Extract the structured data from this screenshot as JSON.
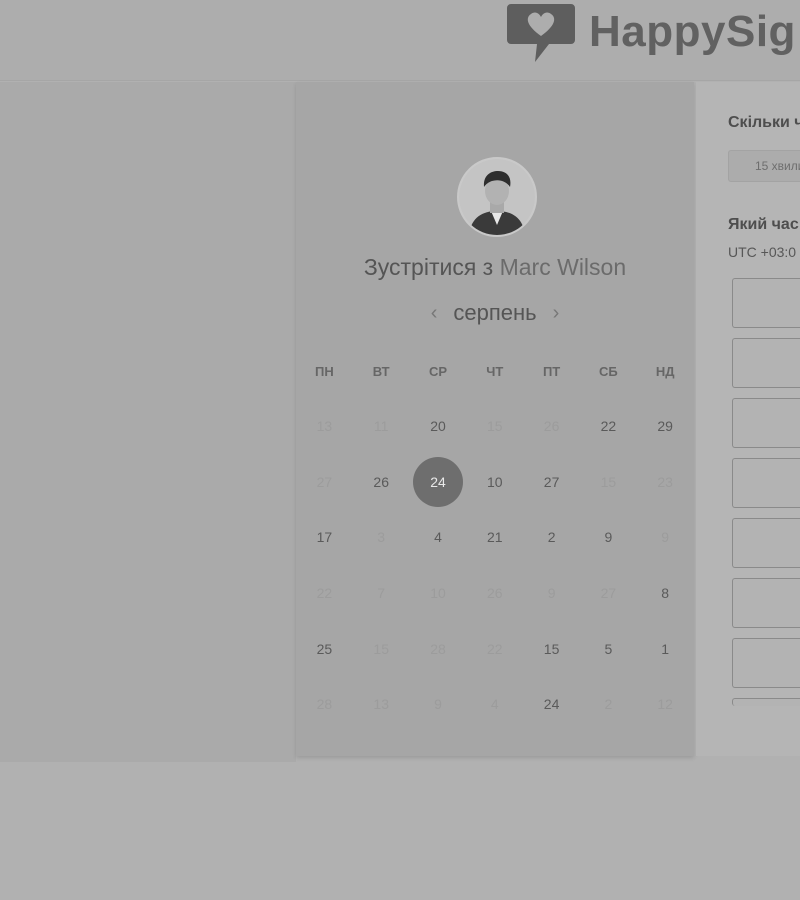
{
  "brand": {
    "name": "HappySig",
    "logo_icon": "heart-speech-bubble-icon",
    "logo_color": "#5e5e5e"
  },
  "calendar": {
    "meet_prefix": "Зустрітися з",
    "meet_name": "Marc Wilson",
    "avatar_icon": "user-avatar",
    "month": "серпень",
    "prev_icon": "chevron-left-icon",
    "next_icon": "chevron-right-icon",
    "prev_glyph": "‹",
    "next_glyph": "›",
    "weekdays": [
      "ПН",
      "ВТ",
      "СР",
      "ЧТ",
      "ПТ",
      "СБ",
      "НД"
    ],
    "weeks": [
      [
        {
          "d": "13",
          "m": true
        },
        {
          "d": "11",
          "m": true
        },
        {
          "d": "20",
          "m": false
        },
        {
          "d": "15",
          "m": true
        },
        {
          "d": "26",
          "m": true
        },
        {
          "d": "22",
          "m": false
        },
        {
          "d": "29",
          "m": false
        }
      ],
      [
        {
          "d": "27",
          "m": true
        },
        {
          "d": "26",
          "m": false
        },
        {
          "d": "24",
          "m": false,
          "sel": true
        },
        {
          "d": "10",
          "m": false
        },
        {
          "d": "27",
          "m": false
        },
        {
          "d": "15",
          "m": true
        },
        {
          "d": "23",
          "m": true
        }
      ],
      [
        {
          "d": "17",
          "m": false
        },
        {
          "d": "3",
          "m": true
        },
        {
          "d": "4",
          "m": false
        },
        {
          "d": "21",
          "m": false
        },
        {
          "d": "2",
          "m": false
        },
        {
          "d": "9",
          "m": false
        },
        {
          "d": "9",
          "m": true
        }
      ],
      [
        {
          "d": "22",
          "m": true
        },
        {
          "d": "7",
          "m": true
        },
        {
          "d": "10",
          "m": true
        },
        {
          "d": "26",
          "m": true
        },
        {
          "d": "9",
          "m": true
        },
        {
          "d": "27",
          "m": true
        },
        {
          "d": "8",
          "m": false
        }
      ],
      [
        {
          "d": "25",
          "m": false
        },
        {
          "d": "15",
          "m": true
        },
        {
          "d": "28",
          "m": true
        },
        {
          "d": "22",
          "m": true
        },
        {
          "d": "15",
          "m": false
        },
        {
          "d": "5",
          "m": false
        },
        {
          "d": "1",
          "m": false
        }
      ],
      [
        {
          "d": "28",
          "m": true
        },
        {
          "d": "13",
          "m": true
        },
        {
          "d": "9",
          "m": true
        },
        {
          "d": "4",
          "m": true
        },
        {
          "d": "24",
          "m": false
        },
        {
          "d": "2",
          "m": true
        },
        {
          "d": "12",
          "m": true
        }
      ]
    ],
    "selected_color": "#6e6e6e"
  },
  "booking": {
    "duration_label": "Скільки ч",
    "duration_value": "15 хвили",
    "time_label": "Який час",
    "timezone": "UTC +03:0",
    "slot_count": 7
  }
}
